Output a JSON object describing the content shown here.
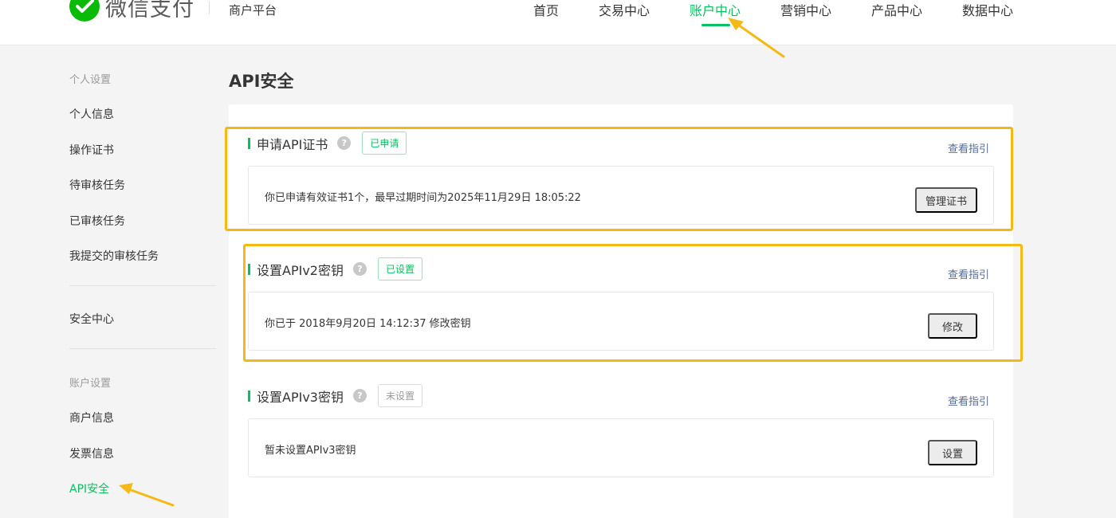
{
  "header": {
    "logo_text": "微信支付",
    "platform": "商户平台",
    "nav": [
      "首页",
      "交易中心",
      "账户中心",
      "营销中心",
      "产品中心",
      "数据中心"
    ],
    "active_nav": "账户中心"
  },
  "sidebar": {
    "group_personal": "个人设置",
    "personal_items": [
      "个人信息",
      "操作证书",
      "待审核任务",
      "已审核任务",
      "我提交的审核任务"
    ],
    "security": "安全中心",
    "group_account": "账户设置",
    "account_items": [
      "商户信息",
      "发票信息",
      "API安全"
    ],
    "active_item": "API安全"
  },
  "main": {
    "title": "API安全",
    "sections": [
      {
        "title": "申请API证书",
        "help": "?",
        "tag": "已申请",
        "tag_status": "done",
        "guide": "查看指引",
        "text": "你已申请有效证书1个，最早过期时间为2025年11月29日 18:05:22",
        "button": "管理证书"
      },
      {
        "title": "设置APIv2密钥",
        "help": "?",
        "tag": "已设置",
        "tag_status": "done",
        "guide": "查看指引",
        "text": "你已于 2018年9月20日 14:12:37 修改密钥",
        "button": "修改"
      },
      {
        "title": "设置APIv3密钥",
        "help": "?",
        "tag": "未设置",
        "tag_status": "pending",
        "guide": "查看指引",
        "text": "暂未设置APIv3密钥",
        "button": "设置"
      }
    ]
  },
  "colors": {
    "brand_green": "#07c160",
    "link_blue": "#576b95",
    "highlight_yellow": "#f5b916"
  },
  "icons": {
    "logo": "wechat-pay-logo-icon",
    "help": "question-circle-icon",
    "annotation": "arrow-annotation-icon"
  }
}
